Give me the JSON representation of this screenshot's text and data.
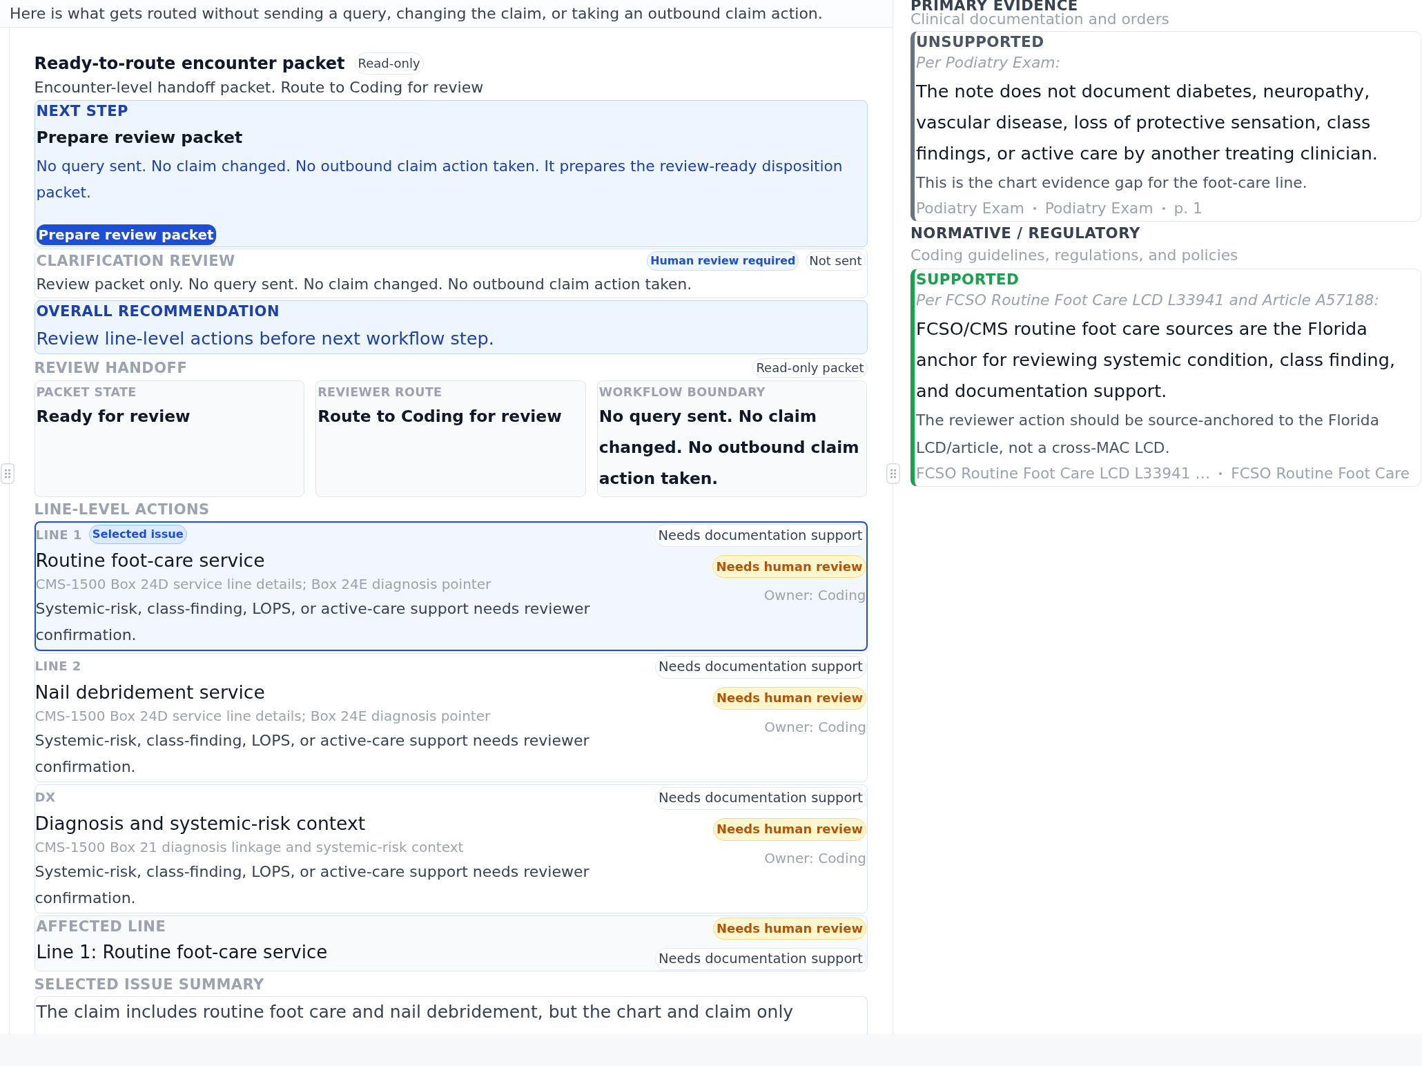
{
  "intro": "Here is what gets routed without sending a query, changing the claim, or taking an outbound claim action.",
  "packet": {
    "title": "Ready-to-route encounter packet",
    "badge": "Read-only",
    "subtitle": "Encounter-level handoff packet. Route to Coding for review"
  },
  "next_step": {
    "label": "NEXT STEP",
    "title": "Prepare review packet",
    "text": "No query sent. No claim changed. No outbound claim action taken. It prepares the review-ready disposition packet.",
    "button": "Prepare review packet"
  },
  "clarification_review": {
    "label": "CLARIFICATION REVIEW",
    "badges": [
      {
        "text": "Human review required",
        "kind": "info"
      },
      {
        "text": "Not sent",
        "kind": "neutral"
      }
    ],
    "text": "Review packet only. No query sent. No claim changed. No outbound claim action taken."
  },
  "overall_recommendation": {
    "label": "OVERALL RECOMMENDATION",
    "text": "Review line-level actions before next workflow step."
  },
  "review_handoff": {
    "label": "REVIEW HANDOFF",
    "badge": "Read-only packet",
    "cards": [
      {
        "label": "PACKET STATE",
        "value": "Ready for review"
      },
      {
        "label": "REVIEWER ROUTE",
        "value": "Route to Coding for review"
      },
      {
        "label": "WORKFLOW BOUNDARY",
        "value": "No query sent. No claim changed. No outbound claim action taken."
      }
    ]
  },
  "line_level_actions": {
    "label": "LINE-LEVEL ACTIONS",
    "lines": [
      {
        "label": "LINE 1",
        "selected": true,
        "badge": "Selected issue",
        "title": "Routine foot-care service",
        "reference": "CMS-1500 Box 24D service line details; Box 24E diagnosis pointer",
        "note": "Systemic-risk, class-finding, LOPS, or active-care support needs reviewer confirmation.",
        "badges": [
          {
            "text": "Needs documentation support",
            "kind": "neutral"
          },
          {
            "text": "Needs human review",
            "kind": "warning"
          }
        ],
        "owner": "Owner: Coding"
      },
      {
        "label": "LINE 2",
        "selected": false,
        "title": "Nail debridement service",
        "reference": "CMS-1500 Box 24D service line details; Box 24E diagnosis pointer",
        "note": "Systemic-risk, class-finding, LOPS, or active-care support needs reviewer confirmation.",
        "badges": [
          {
            "text": "Needs documentation support",
            "kind": "neutral"
          },
          {
            "text": "Needs human review",
            "kind": "warning"
          }
        ],
        "owner": "Owner: Coding"
      },
      {
        "label": "DX",
        "selected": false,
        "title": "Diagnosis and systemic-risk context",
        "reference": "CMS-1500 Box 21 diagnosis linkage and systemic-risk context",
        "note": "Systemic-risk, class-finding, LOPS, or active-care support needs reviewer confirmation.",
        "badges": [
          {
            "text": "Needs documentation support",
            "kind": "neutral"
          },
          {
            "text": "Needs human review",
            "kind": "warning"
          }
        ],
        "owner": "Owner: Coding"
      }
    ]
  },
  "affected_line": {
    "label": "AFFECTED LINE",
    "value": "Line 1: Routine foot-care service",
    "badges": [
      {
        "text": "Needs human review",
        "kind": "warning"
      },
      {
        "text": "Needs documentation support",
        "kind": "neutral"
      }
    ]
  },
  "selected_issue_summary": {
    "label": "SELECTED ISSUE SUMMARY",
    "text": "The claim includes routine foot care and nail debridement, but the chart and claim only"
  },
  "evidence_sections": [
    {
      "heading": "PRIMARY EVIDENCE",
      "subheading": "Clinical documentation and orders",
      "cards": [
        {
          "kind": "unsupported",
          "verdict": "UNSUPPORTED",
          "citation": "Per Podiatry Exam:",
          "finding": "The note does not document diabetes, neuropathy, vascular disease, loss of protective sensation, class findings, or active care by another treating clinician.",
          "note": "This is the chart evidence gap for the foot-care line.",
          "sources": [
            "Podiatry Exam",
            "Podiatry Exam",
            "p. 1"
          ]
        }
      ]
    },
    {
      "heading": "NORMATIVE / REGULATORY",
      "subheading": "Coding guidelines, regulations, and policies",
      "cards": [
        {
          "kind": "supported",
          "verdict": "SUPPORTED",
          "citation": "Per FCSO Routine Foot Care LCD L33941 and Article A57188:",
          "finding": "FCSO/CMS routine foot care sources are the Florida anchor for reviewing systemic condition, class finding, and documentation support.",
          "note": "The reviewer action should be source-anchored to the Florida LCD/article, not a cross-MAC LCD.",
          "sources": [
            "FCSO Routine Foot Care LCD L33941 …",
            "FCSO Routine Foot Care"
          ]
        }
      ]
    }
  ]
}
